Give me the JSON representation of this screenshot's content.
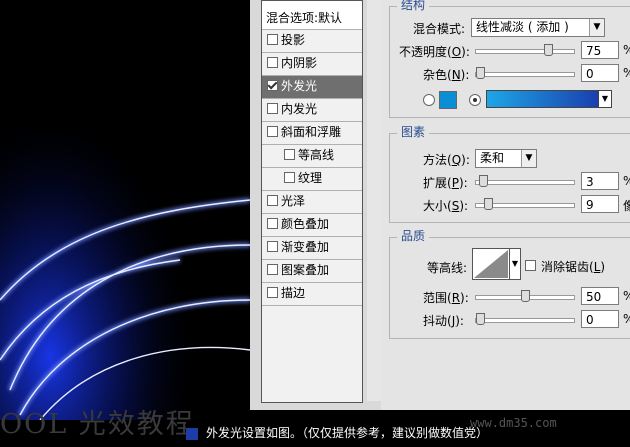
{
  "styles_panel": {
    "header": "混合选项:默认",
    "items": [
      {
        "label": "投影",
        "checked": false,
        "indent": false
      },
      {
        "label": "内阴影",
        "checked": false,
        "indent": false
      },
      {
        "label": "外发光",
        "checked": true,
        "indent": false,
        "selected": true
      },
      {
        "label": "内发光",
        "checked": false,
        "indent": false
      },
      {
        "label": "斜面和浮雕",
        "checked": false,
        "indent": false
      },
      {
        "label": "等高线",
        "checked": false,
        "indent": true
      },
      {
        "label": "纹理",
        "checked": false,
        "indent": true
      },
      {
        "label": "光泽",
        "checked": false,
        "indent": false
      },
      {
        "label": "颜色叠加",
        "checked": false,
        "indent": false
      },
      {
        "label": "渐变叠加",
        "checked": false,
        "indent": false
      },
      {
        "label": "图案叠加",
        "checked": false,
        "indent": false
      },
      {
        "label": "描边",
        "checked": false,
        "indent": false
      }
    ]
  },
  "structure": {
    "title": "结构",
    "blend_mode_label": "混合模式:",
    "blend_mode_value": "线性减淡 ( 添加 )",
    "opacity_label": "不透明度(",
    "opacity_key": "O",
    "opacity_value": "75",
    "opacity_unit": "%",
    "noise_label": "杂色(",
    "noise_key": "N",
    "noise_value": "0",
    "noise_unit": "%",
    "swatch_color": "#0a8fd6",
    "gradient_from": "#1a3fae",
    "gradient_to": "#1ea6e6",
    "opacity_level": 75,
    "noise_level": 0
  },
  "elements": {
    "title": "图素",
    "method_label": "方法(",
    "method_key": "Q",
    "method_value": "柔和",
    "spread_label": "扩展(",
    "spread_key": "P",
    "spread_value": "3",
    "spread_unit": "%",
    "size_label": "大小(",
    "size_key": "S",
    "size_value": "9",
    "size_unit": "像",
    "spread_level": 3,
    "size_level": 9
  },
  "quality": {
    "title": "品质",
    "contour_label": "等高线:",
    "antialias_label": "消除锯齿(",
    "antialias_key": "L",
    "range_label": "范围(",
    "range_key": "R",
    "range_value": "50",
    "range_unit": "%",
    "jitter_label": "抖动(",
    "jitter_key": "J",
    "jitter_value": "0",
    "jitter_unit": "%",
    "range_level": 50,
    "jitter_level": 0
  },
  "caption": "外发光设置如图。（仅仅提供参考，建议别做数值党）",
  "brand_url": "www.dm35.com",
  "watermark": "OOL  光效教程"
}
